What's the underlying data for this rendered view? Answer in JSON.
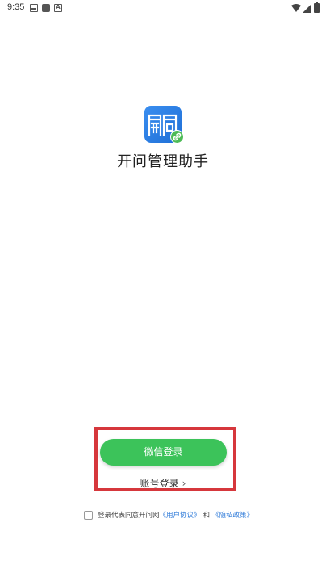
{
  "status_bar": {
    "time": "9:35",
    "icons": [
      "image-icon",
      "notification-square-icon",
      "a-icon",
      "wifi-icon",
      "signal-icon",
      "battery-icon"
    ]
  },
  "app": {
    "name": "开问管理助手",
    "logo_text": "開問",
    "logo_color": "#2d7fe6",
    "badge_color": "#4dbb56"
  },
  "login": {
    "wechat_button": "微信登录",
    "account_login": "账号登录",
    "account_chevron": "›",
    "button_color": "#3cc35a",
    "highlight_color": "#d6373c"
  },
  "agreement": {
    "prefix": "登录代表同意开问网",
    "user_agreement": "《用户协议》",
    "and": "和",
    "privacy_policy": "《隐私政策》"
  }
}
